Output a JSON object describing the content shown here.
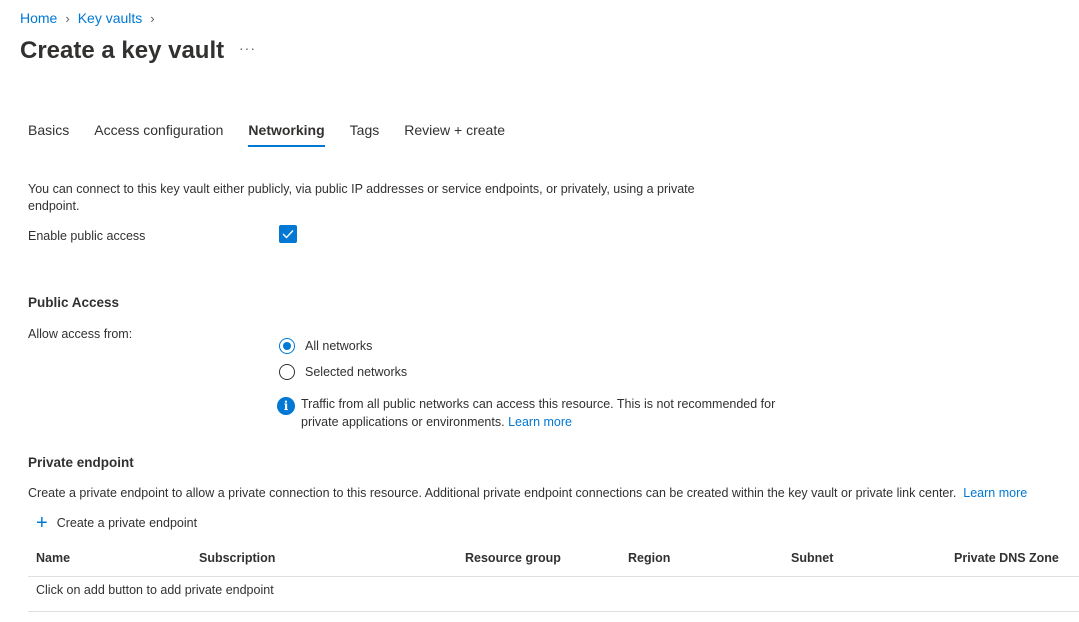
{
  "breadcrumb": {
    "items": [
      "Home",
      "Key vaults"
    ]
  },
  "page": {
    "title": "Create a key vault",
    "more_label": "···"
  },
  "tabs": [
    {
      "label": "Basics",
      "active": false
    },
    {
      "label": "Access configuration",
      "active": false
    },
    {
      "label": "Networking",
      "active": true
    },
    {
      "label": "Tags",
      "active": false
    },
    {
      "label": "Review + create",
      "active": false
    }
  ],
  "networking": {
    "intro": "You can connect to this key vault either publicly, via public IP addresses or service endpoints, or privately, using a private endpoint.",
    "enable_public_access_label": "Enable public access",
    "enable_public_access_checked": true
  },
  "public_access": {
    "title": "Public Access",
    "allow_label": "Allow access from:",
    "options": [
      {
        "label": "All networks",
        "selected": true
      },
      {
        "label": "Selected networks",
        "selected": false
      }
    ],
    "info_text": "Traffic from all public networks can access this resource. This is not recommended for private applications or environments.",
    "info_link": "Learn more"
  },
  "private_endpoint": {
    "title": "Private endpoint",
    "description": "Create a private endpoint to allow a private connection to this resource. Additional private endpoint connections can be created within the key vault or private link center.",
    "learn_more": "Learn more",
    "add_label": "Create a private endpoint",
    "columns": [
      "Name",
      "Subscription",
      "Resource group",
      "Region",
      "Subnet",
      "Private DNS Zone"
    ],
    "empty_message": "Click on add button to add private endpoint"
  },
  "colors": {
    "accent": "#0078d4",
    "text": "#323130",
    "divider": "#e1dfdd"
  }
}
